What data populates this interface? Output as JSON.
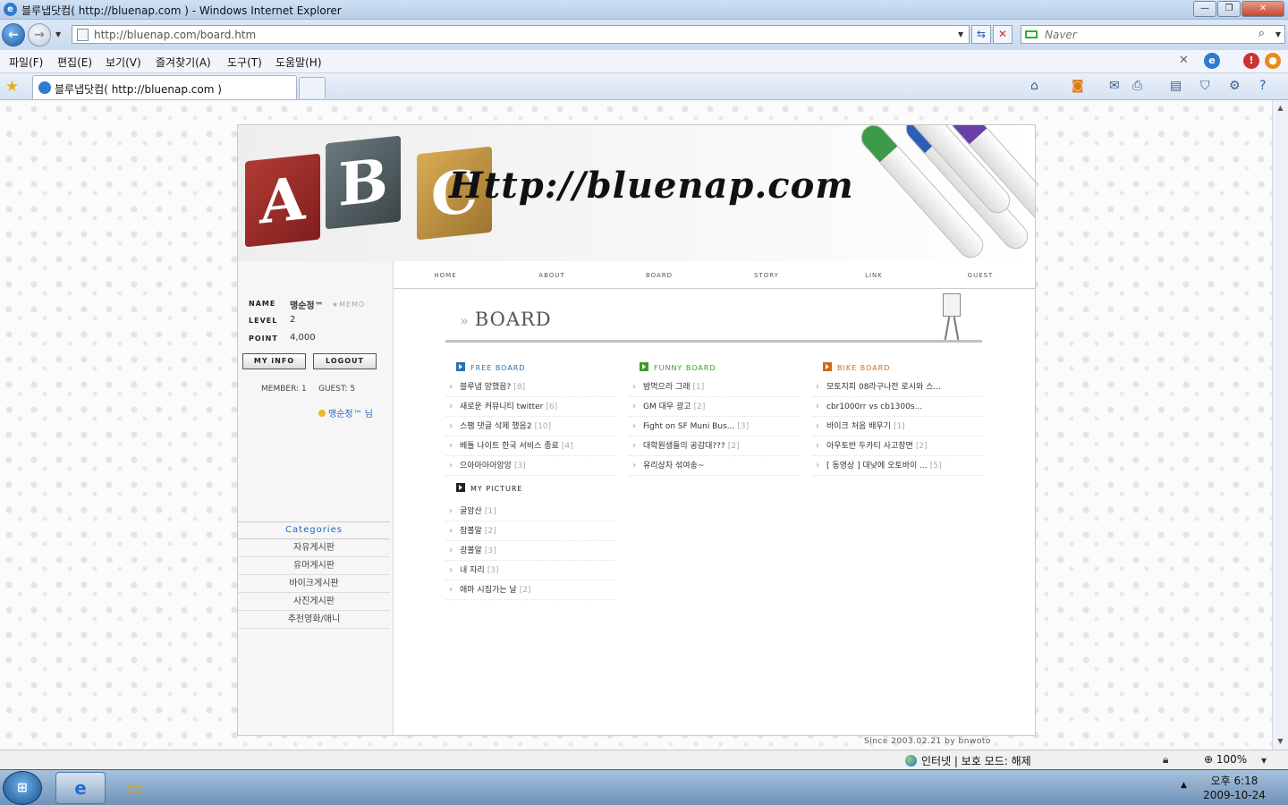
{
  "window": {
    "title": "블루냅닷컴( http://bluenap.com ) - Windows Internet Explorer",
    "min": "—",
    "max": "❐",
    "close": "✕"
  },
  "address": {
    "url": "http://bluenap.com/board.htm",
    "search_placeholder": "Naver"
  },
  "menu": [
    "파일(F)",
    "편집(E)",
    "보기(V)",
    "즐겨찾기(A)",
    "도구(T)",
    "도움말(H)"
  ],
  "tab": {
    "title": "블루냅닷컴( http://bluenap.com )"
  },
  "icons": {
    "back": "back-arrow-icon",
    "forward": "forward-arrow-icon",
    "refresh": "refresh-icon",
    "stop": "stop-icon",
    "search": "search-icon",
    "favorites": "star-icon",
    "home": "home-icon",
    "feeds": "rss-icon",
    "print": "printer-icon",
    "page": "page-icon",
    "safety": "shield-icon",
    "tools": "gear-icon",
    "help": "help-icon"
  },
  "banner": {
    "url_text": "Http://bluenap.com",
    "blocks": [
      "A",
      "B",
      "C"
    ]
  },
  "user": {
    "name_label": "NAME",
    "name": "맹순정™",
    "memo": "★MEMO",
    "level_label": "LEVEL",
    "level": "2",
    "point_label": "POINT",
    "point": "4,000",
    "myinfo_btn": "MY iNFO",
    "logout_btn": "LOGOUT",
    "members": "MEMBER: 1",
    "guests": "GUEST: 5",
    "greeting": "맹순정™ 님"
  },
  "categories": {
    "title": "Categories",
    "items": [
      "자유게시판",
      "유머게시판",
      "바이크게시판",
      "사진게시판",
      "추천영화/애니"
    ]
  },
  "nav": [
    "HOME",
    "ABOUT",
    "BOARD",
    "STORY",
    "LINK",
    "GUEST"
  ],
  "board_title": "BOARD",
  "sections": {
    "free": {
      "title": "FREE BOARD",
      "color": "#2a6fb0",
      "items": [
        {
          "t": "블루냅 망했음?",
          "c": "[8]"
        },
        {
          "t": "새로운 커뮤니티 twitter",
          "c": "[6]"
        },
        {
          "t": "스팸 댓글 삭제 했음2",
          "c": "[10]"
        },
        {
          "t": "베틀 나이트 한국 서비스 종료",
          "c": "[4]"
        },
        {
          "t": "으아아아아앙앙",
          "c": "[3]"
        }
      ]
    },
    "funny": {
      "title": "FUNNY BOARD",
      "color": "#3f9a2e",
      "items": [
        {
          "t": "밤먹으라 그래",
          "c": "[1]"
        },
        {
          "t": "GM 대우 광고",
          "c": "[2]"
        },
        {
          "t": "Fight on SF Muni Bus...",
          "c": "[3]"
        },
        {
          "t": "대학원생들의 공감대???",
          "c": "[2]"
        },
        {
          "t": "유리상자 섞여송~",
          "c": ""
        }
      ]
    },
    "bike": {
      "title": "BIKE BOARD",
      "color": "#d06a18",
      "items": [
        {
          "t": "모토지피 08라구나전 로시와 스...",
          "c": ""
        },
        {
          "t": "cbr1000rr vs cb1300s...",
          "c": ""
        },
        {
          "t": "바이크 처음 배우기",
          "c": "[1]"
        },
        {
          "t": "아우토반 두카티 사고장면",
          "c": "[2]"
        },
        {
          "t": "[ 동영상 ] 대낮에 오토바이 ...",
          "c": "[5]"
        }
      ]
    },
    "picture": {
      "title": "MY PICTURE",
      "color": "#222222",
      "items": [
        {
          "t": "굴암산",
          "c": "[1]"
        },
        {
          "t": "잠볼알",
          "c": "[2]"
        },
        {
          "t": "광볼알",
          "c": "[3]"
        },
        {
          "t": "내 자리",
          "c": "[3]"
        },
        {
          "t": "애마 시집가는 날",
          "c": "[2]"
        }
      ]
    }
  },
  "footer": "Since 2003.02.21 by bnwoto",
  "status": {
    "zone": "인터넷 | 보호 모드: 해제",
    "zoom": "100%"
  },
  "clock": {
    "time": "오후 6:18",
    "date": "2009-10-24"
  }
}
